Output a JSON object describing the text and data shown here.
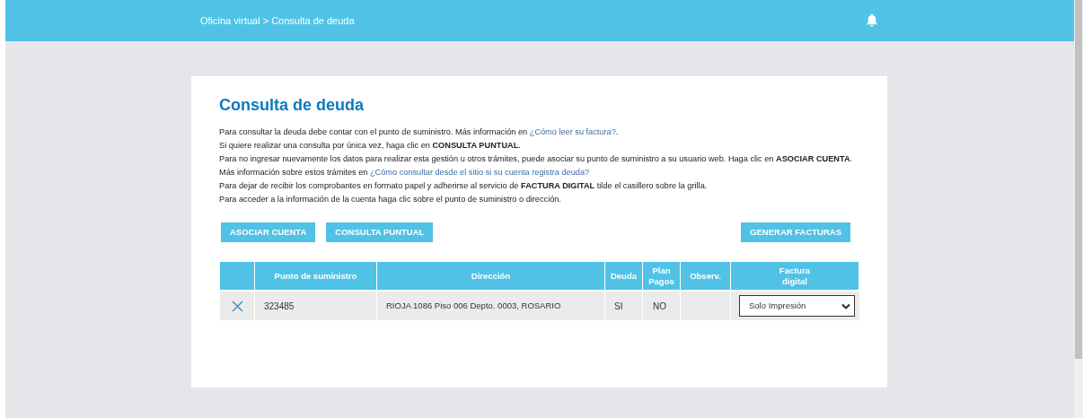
{
  "header": {
    "breadcrumb": "Oficina virtual > Consulta de deuda"
  },
  "card": {
    "title": "Consulta de deuda",
    "paragraphs": [
      [
        {
          "kind": "text",
          "text": "Para consultar la deuda debe contar con el punto de suministro. Más información en "
        },
        {
          "kind": "link",
          "text": "¿Cómo leer su factura?"
        },
        {
          "kind": "text",
          "text": "."
        }
      ],
      [
        {
          "kind": "text",
          "text": "Si quiere realizar una consulta por única vez, haga clic en **CONSULTA PUNTUAL**."
        }
      ],
      [
        {
          "kind": "text",
          "text": "Para no ingresar nuevamente los datos para realizar esta gestión u otros trámites, puede asociar su punto de suministro a su usuario web. Haga clic en **ASOCIAR CUENTA**."
        }
      ],
      [
        {
          "kind": "text",
          "text": "Más información sobre estos trámites en "
        },
        {
          "kind": "link",
          "text": "¿Cómo consultar desde el sitio si su cuenta registra deuda?"
        }
      ],
      [
        {
          "kind": "text",
          "text": "Para dejar de recibir los comprobantes en formato papel y adherirse al servicio de **FACTURA DIGITAL** tilde el casillero sobre la grilla."
        }
      ],
      [
        {
          "kind": "text",
          "text": "Para acceder a la información de la cuenta haga clic sobre el punto de suministro o dirección."
        }
      ]
    ],
    "buttons_left": [
      "ASOCIAR CUENTA",
      "CONSULTA PUNTUAL"
    ],
    "buttons_right": [
      "GENERAR FACTURAS"
    ],
    "table": {
      "columns": [
        "",
        "Punto de suministro",
        "Dirección",
        "Deuda",
        "Plan Pagos",
        "Observ.",
        "Factura digital"
      ],
      "rows": [
        {
          "punto": "323485",
          "direccion": "RIOJA 1086 Piso 006 Depto. 0003, ROSARIO",
          "deuda": "SI",
          "plan": "NO",
          "factura": "Solo Impresión"
        }
      ]
    }
  }
}
